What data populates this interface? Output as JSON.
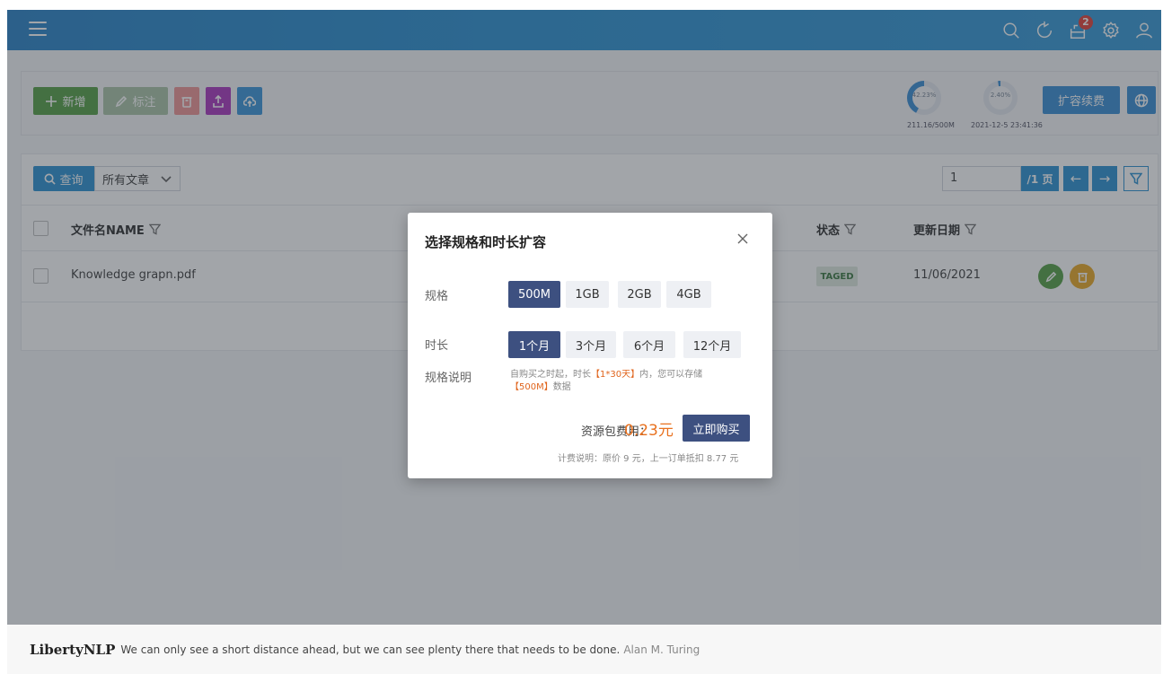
{
  "header": {
    "icons": [
      "menu-icon",
      "search-icon",
      "refresh-icon",
      "export-icon",
      "settings-icon",
      "user-icon"
    ],
    "notification_count": "2"
  },
  "toolbar": {
    "add_label": "新增",
    "tag_label": "标注",
    "usage_gauge": {
      "value": 42.23,
      "text": "42.23%",
      "caption": "211.16/500M"
    },
    "time_gauge": {
      "value": 2.4,
      "text": "2.40%",
      "caption": "2021-12-5 23:41:36"
    },
    "expand_label": "扩容续费",
    "colors": {
      "add": "#4c9a3a",
      "tag": "#a6c0a2",
      "delete": "#ee8e8e",
      "upload": "#a52bba",
      "cloud": "#2e8fd6"
    }
  },
  "query": {
    "search_label": "查询",
    "filter_value": "所有文章"
  },
  "pager": {
    "page_value": "1",
    "total_label": "/1 页",
    "prev": "←",
    "next": "→"
  },
  "table": {
    "columns": {
      "name": "文件名NAME",
      "status": "状态",
      "date": "更新日期"
    },
    "rows": [
      {
        "name": "Knowledge grapn.pdf",
        "status": "TAGED",
        "date": "11/06/2021"
      }
    ]
  },
  "modal": {
    "title": "选择规格和时长扩容",
    "spec_label": "规格",
    "spec_options": [
      "500M",
      "1GB",
      "2GB",
      "4GB"
    ],
    "spec_selected": "500M",
    "duration_label": "时长",
    "duration_options": [
      "1个月",
      "3个月",
      "6个月",
      "12个月"
    ],
    "duration_selected": "1个月",
    "desc_label": "规格说明",
    "desc_part1": "自购买之时起，时长",
    "desc_hl1": "【1*30天】",
    "desc_part2": "内，您可以存储",
    "desc_hl2": "【500M】",
    "desc_part3": "数据",
    "fee_label": "资源包费用：",
    "fee_value": "0.23元",
    "buy_label": "立即购买",
    "fee_note": "计费说明：原价 9 元，上一订单抵扣 8.77 元"
  },
  "footer": {
    "brand": "LibertyNLP",
    "quote": "We can only see a short distance ahead, but we can see plenty there that needs to be done.",
    "author": "Alan M. Turing"
  }
}
